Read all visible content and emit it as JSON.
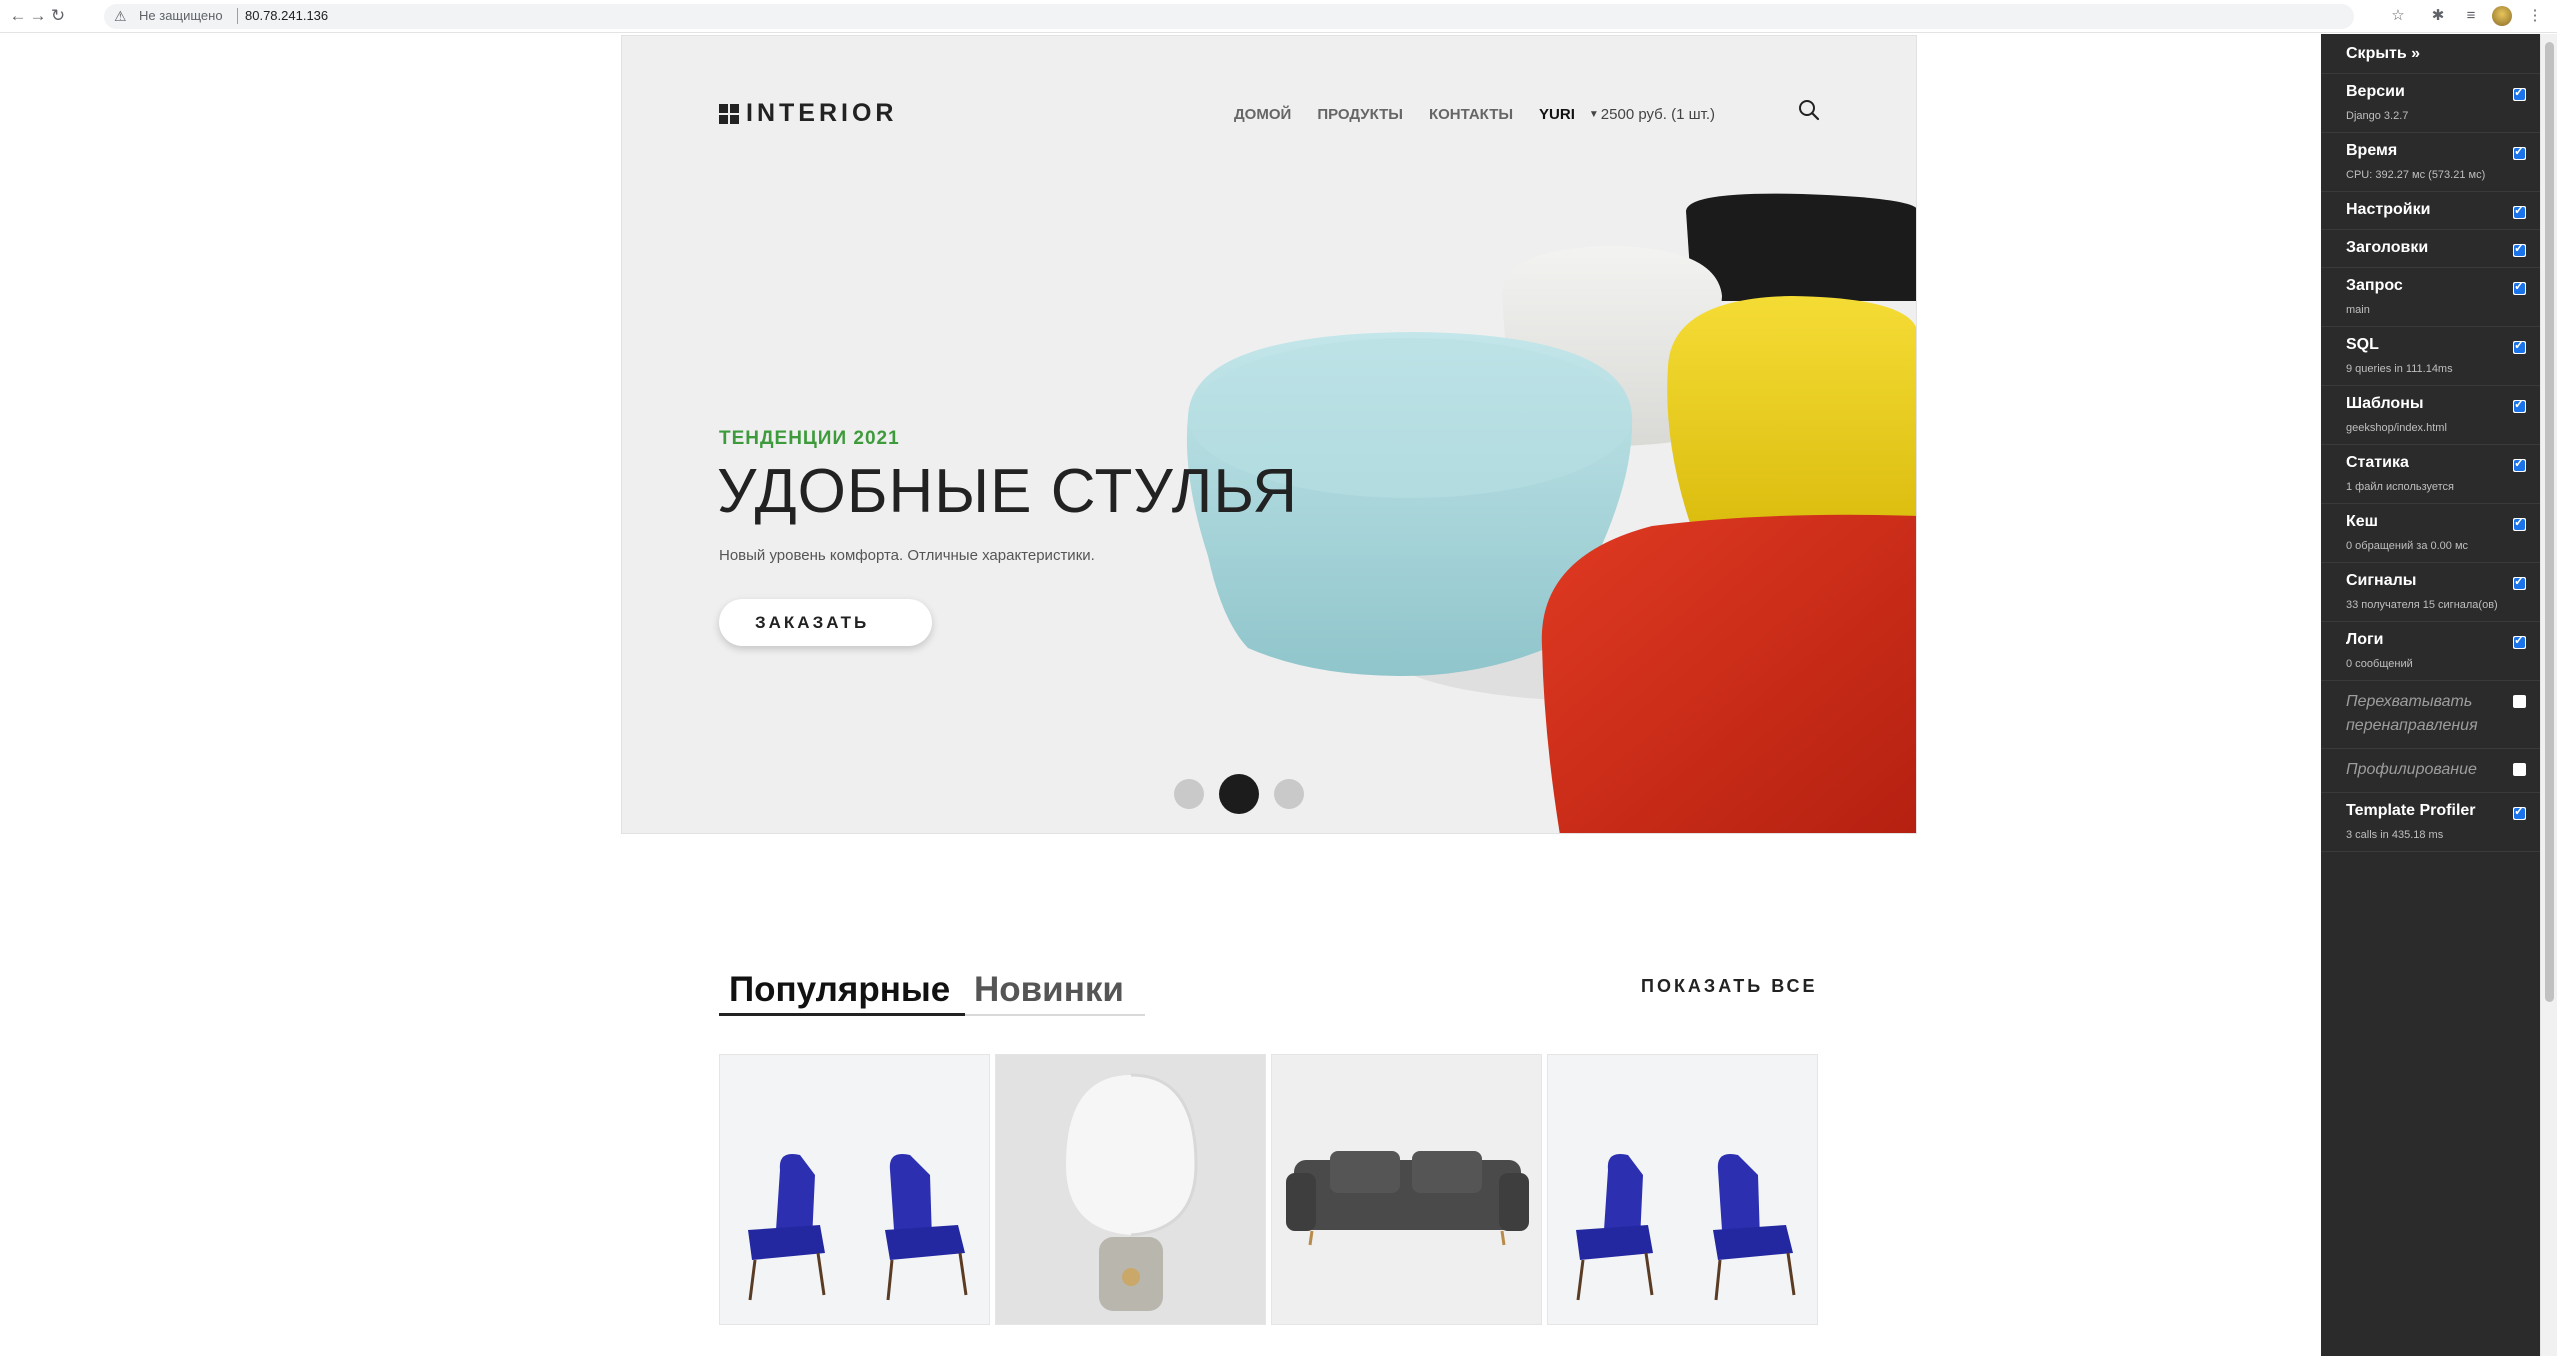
{
  "browser": {
    "security_label": "Не защищено",
    "url": "80.78.241.136"
  },
  "site": {
    "logo_text": "INTERIOR",
    "nav": [
      "ДОМОЙ",
      "ПРОДУКТЫ",
      "КОНТАКТЫ"
    ],
    "user": "YURI",
    "cart": "2500 руб. (1 шт.)"
  },
  "hero": {
    "tagline": "ТЕНДЕНЦИИ 2021",
    "headline": "УДОБНЫЕ СТУЛЬЯ",
    "subline": "Новый уровень комфорта. Отличные характеристики.",
    "button": "ЗАКАЗАТЬ",
    "slides_total": 3,
    "active_slide": 2,
    "colors": {
      "accent_green": "#3e9b3c",
      "pouf_blue": "#a9d8dd",
      "pouf_yellow": "#f0d21b",
      "pouf_red": "#d8301a",
      "pouf_black": "#1a1a1a",
      "pouf_white": "#e9e9e6"
    }
  },
  "tabs": {
    "popular": "Популярные",
    "novelty": "Новинки",
    "show_all": "ПОКАЗАТЬ ВСЕ"
  },
  "products": [
    {
      "name": "blue-armchairs"
    },
    {
      "name": "globe-lamp"
    },
    {
      "name": "grey-sofa"
    },
    {
      "name": "blue-armchairs"
    }
  ],
  "debug_toolbar": {
    "hide_label": "Скрыть »",
    "panels": [
      {
        "title": "Версии",
        "sub": "Django 3.2.7",
        "checked": true
      },
      {
        "title": "Время",
        "sub": "CPU: 392.27 мс (573.21 мс)",
        "checked": true
      },
      {
        "title": "Настройки",
        "sub": "",
        "checked": true
      },
      {
        "title": "Заголовки",
        "sub": "",
        "checked": true
      },
      {
        "title": "Запрос",
        "sub": "main",
        "checked": true
      },
      {
        "title": "SQL",
        "sub": "9 queries in 111.14ms",
        "checked": true
      },
      {
        "title": "Шаблоны",
        "sub": "geekshop/index.html",
        "checked": true
      },
      {
        "title": "Статика",
        "sub": "1 файл используется",
        "checked": true
      },
      {
        "title": "Кеш",
        "sub": "0 обращений за 0.00 мс",
        "checked": true
      },
      {
        "title": "Сигналы",
        "sub": "33 получателя 15 сигнала(ов)",
        "checked": true
      },
      {
        "title": "Логи",
        "sub": "0 сообщений",
        "checked": true
      },
      {
        "title": "Перехватывать перенаправления",
        "sub": "",
        "checked": false
      },
      {
        "title": "Профилирование",
        "sub": "",
        "checked": false
      },
      {
        "title": "Template Profiler",
        "sub": "3 calls in 435.18 ms",
        "checked": true
      }
    ]
  }
}
